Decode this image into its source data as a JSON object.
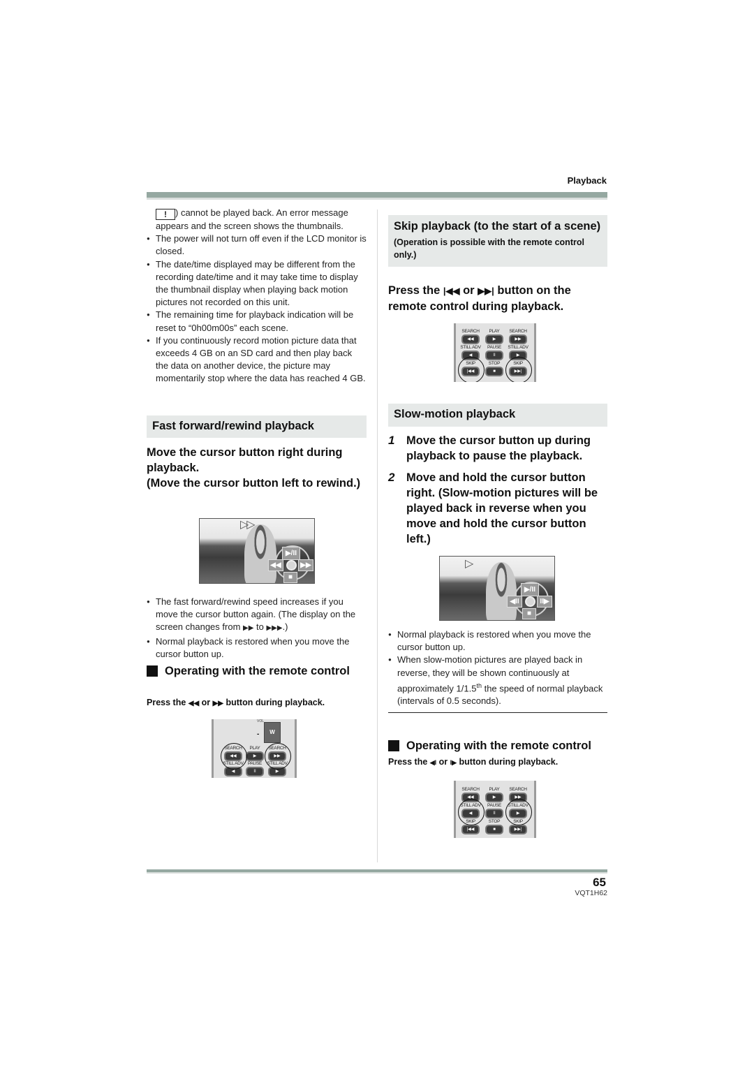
{
  "header": {
    "section": "Playback"
  },
  "left": {
    "intro_prefix_icon": "warning-exclamation-icon",
    "intro_prefix_symbol": "!",
    "intro_line": ") cannot be played back. An error message appears and the screen shows the thumbnails.",
    "notes": [
      "The power will not turn off even if the LCD monitor is closed.",
      "The date/time displayed may be different from the recording date/time and it may take time to display the thumbnail display when playing back motion pictures not recorded on this unit.",
      "The remaining time for playback indication will be reset to “0h00m00s” each scene.",
      "If you continuously record motion picture data that exceeds 4 GB on an SD card and then play back the data on another device, the picture may momentarily stop where the data has reached 4 GB."
    ],
    "ff_section": {
      "title": "Fast forward/rewind playback",
      "instruction_line1": "Move the cursor button right during playback.",
      "instruction_line2": "(Move the cursor button left to rewind.)",
      "screen": {
        "osd_icon": "fast-forward-outline-icon",
        "osd_symbol": "▷▷",
        "controls": {
          "top": "▶/II",
          "left": "◀◀",
          "right": "▶▶",
          "bottom": "■"
        }
      },
      "notes_a_pre": "The fast forward/rewind speed increases if you move the cursor button again. (The display on the screen changes from ",
      "notes_a_sym1": "▶▶",
      "notes_a_mid": " to ",
      "notes_a_sym2": "▶▶▶",
      "notes_a_post": ".)",
      "notes_b": "Normal playback is restored when you move the cursor button up."
    },
    "remote_section": {
      "title": "Operating with the remote control",
      "press_pre": "Press the ",
      "press_sym1": "◀◀",
      "press_mid": " or ",
      "press_sym2": "▶▶",
      "press_post": " button during playback.",
      "remote": {
        "vol": "VOL",
        "w": "W",
        "search_l": "SEARCH",
        "play": "PLAY",
        "search_r": "SEARCH",
        "still_l": "STILL ADV",
        "pause": "PAUSE",
        "still_r": "STILL ADV"
      }
    }
  },
  "right": {
    "skip_section": {
      "title": "Skip playback (to the start of a scene)",
      "subtitle": "(Operation is possible with the remote control only.)",
      "press_pre": "Press the ",
      "press_sym1": "|◀◀",
      "press_mid": " or ",
      "press_sym2": "▶▶|",
      "press_post": " button on the remote control during playback.",
      "remote": {
        "search_l": "SEARCH",
        "play": "PLAY",
        "search_r": "SEARCH",
        "still_l": "STILL ADV",
        "pause": "PAUSE",
        "still_r": "STILL ADV",
        "skip_l": "SKIP",
        "stop": "STOP",
        "skip_r": "SKIP"
      }
    },
    "slow_section": {
      "title": "Slow-motion playback",
      "steps": [
        {
          "num": "1",
          "text": "Move the cursor button up during playback to pause the playback."
        },
        {
          "num": "2",
          "text": "Move and hold the cursor button right. (Slow-motion pictures will be played back in reverse when you move and hold the cursor button left.)"
        }
      ],
      "screen": {
        "osd_symbol": "▷",
        "controls": {
          "top": "▶/II",
          "left": "◀II",
          "right": "II▶",
          "bottom": "■"
        }
      },
      "note_a": "Normal playback is restored when you move the cursor button up.",
      "note_b_pre": "When slow-motion pictures are played back in reverse, they will be shown continuously at approximately 1/1.5",
      "note_b_sup": "th",
      "note_b_post": " the speed of normal playback (intervals of 0.5 seconds)."
    },
    "remote_section": {
      "title": "Operating with the remote control",
      "press_pre": "Press the ",
      "press_sym1": "◀I",
      "press_mid": " or ",
      "press_sym2": "I▶",
      "press_post": " button during playback.",
      "remote": {
        "search_l": "SEARCH",
        "play": "PLAY",
        "search_r": "SEARCH",
        "still_l": "STILL ADV",
        "pause": "PAUSE",
        "still_r": "STILL ADV",
        "skip_l": "SKIP",
        "stop": "STOP",
        "skip_r": "SKIP"
      }
    }
  },
  "footer": {
    "page_number": "65",
    "doc_code": "VQT1H62"
  }
}
